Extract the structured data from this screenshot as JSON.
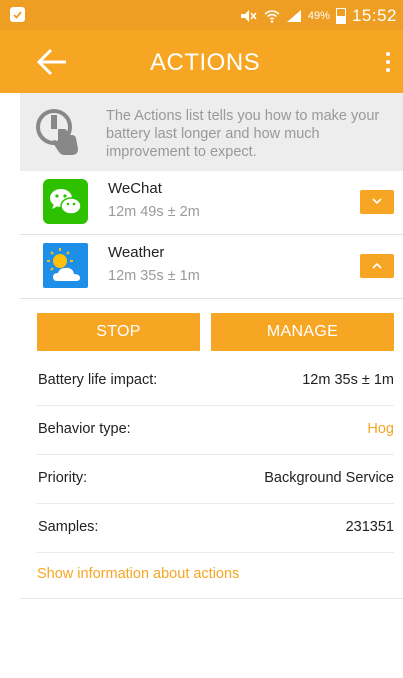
{
  "status_bar": {
    "battery_percent": "49%",
    "battery_level": 0.49,
    "time": "15:52"
  },
  "app_bar": {
    "title": "ACTIONS"
  },
  "info_banner": {
    "text": "The Actions list tells you how to make your battery last longer and how much improvement to expect."
  },
  "apps": [
    {
      "name": "WeChat",
      "estimate": "12m 49s ± 2m",
      "expanded": false,
      "icon": "wechat-icon"
    },
    {
      "name": "Weather",
      "estimate": "12m 35s ± 1m",
      "expanded": true,
      "icon": "weather-icon"
    }
  ],
  "buttons": {
    "stop": "STOP",
    "manage": "MANAGE"
  },
  "details": [
    {
      "label": "Battery life impact:",
      "value": "12m 35s ± 1m",
      "highlight": false
    },
    {
      "label": "Behavior type:",
      "value": "Hog",
      "highlight": true
    },
    {
      "label": "Priority:",
      "value": "Background Service",
      "highlight": false
    },
    {
      "label": "Samples:",
      "value": "231351",
      "highlight": false
    }
  ],
  "link": {
    "text": "Show information about actions"
  },
  "colors": {
    "accent": "#F6A623",
    "status_bar": "#ED9E23",
    "banner_bg": "#EDEDED"
  }
}
